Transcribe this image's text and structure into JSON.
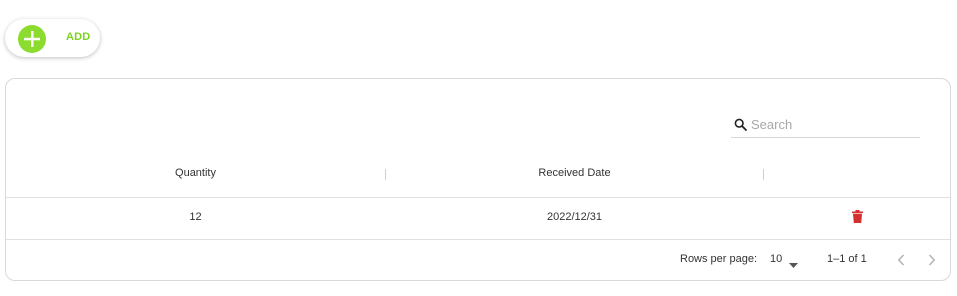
{
  "toolbar": {
    "add_label": "ADD"
  },
  "search": {
    "placeholder": "Search",
    "value": ""
  },
  "table": {
    "columns": [
      "Quantity",
      "Received Date",
      ""
    ],
    "rows": [
      {
        "quantity": "12",
        "received_date": "2022/12/31"
      }
    ]
  },
  "pagination": {
    "rows_per_page_label": "Rows per page:",
    "rows_per_page_value": "10",
    "range_label": "1–1 of 1"
  },
  "colors": {
    "accent_green": "#8bdc2e",
    "add_text_green": "#7ed321",
    "delete_red": "#d32f2f"
  },
  "icons": [
    "plus-icon",
    "search-icon",
    "trash-icon",
    "caret-down-icon",
    "chevron-left-icon",
    "chevron-right-icon"
  ]
}
